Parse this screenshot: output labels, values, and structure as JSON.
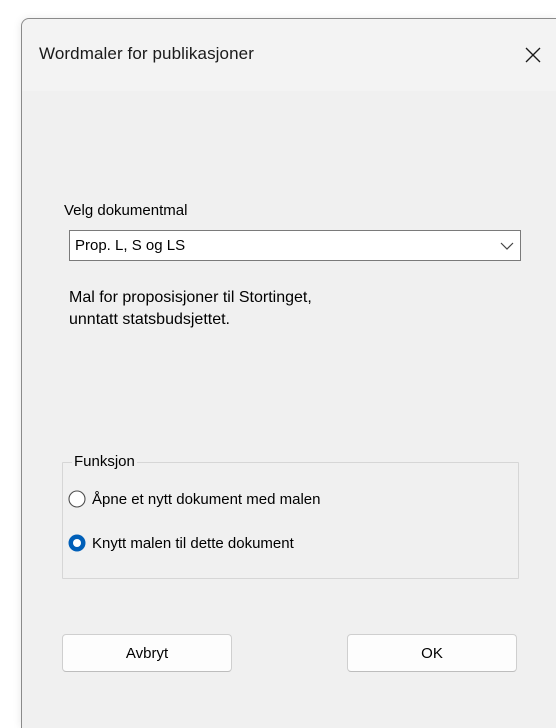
{
  "dialog": {
    "title": "Wordmaler for publikasjoner",
    "close_icon": "close-icon"
  },
  "template_select": {
    "label": "Velg dokumentmal",
    "selected_value": "Prop. L, S og LS",
    "arrow_icon": "chevron-down-icon"
  },
  "description": {
    "line1": "Mal for proposisjoner til Stortinget,",
    "line2": "unntatt statsbudsjettet."
  },
  "function_group": {
    "legend": "Funksjon",
    "options": [
      {
        "label": "Åpne et nytt dokument med malen",
        "selected": false
      },
      {
        "label": "Knytt malen til dette dokument",
        "selected": true
      }
    ]
  },
  "buttons": {
    "cancel_label": "Avbryt",
    "ok_label": "OK"
  },
  "colors": {
    "dialog_background": "#f0f0f0",
    "accent": "#005fb8"
  }
}
